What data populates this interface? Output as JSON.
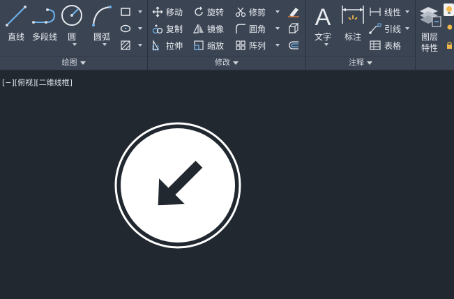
{
  "draw_panel": {
    "title": "绘图",
    "line": "直线",
    "polyline": "多段线",
    "circle": "圆",
    "arc": "圆弧"
  },
  "modify_panel": {
    "title": "修改",
    "move": "移动",
    "rotate": "旋转",
    "trim": "修剪",
    "copy": "复制",
    "mirror": "镜像",
    "fillet": "圆角",
    "stretch": "拉伸",
    "scale": "缩放",
    "array": "阵列"
  },
  "annotation_panel": {
    "title": "注释",
    "text": "文字",
    "dimension": "标注",
    "linear": "线性",
    "leader": "引线",
    "table": "表格"
  },
  "layers_panel": {
    "layer_properties_line1": "图层",
    "layer_properties_line2": "特性"
  },
  "viewport": {
    "label": "[−][俯视][二维线框]"
  },
  "colors": {
    "ribbon_bg": "#3b4453",
    "canvas_bg": "#212830",
    "accent_blue": "#6db4ef",
    "drawing_white": "#ffffff"
  }
}
